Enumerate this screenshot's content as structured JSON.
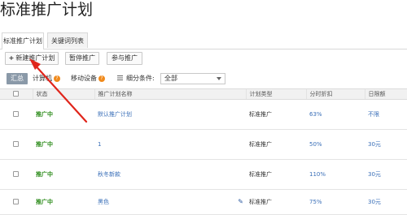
{
  "page": {
    "title": "标准推广计划"
  },
  "tabs": [
    {
      "label": "标准推广计划",
      "active": true
    },
    {
      "label": "关键词列表",
      "active": false
    }
  ],
  "toolbar": {
    "new_plan": "新建推广计划",
    "pause": "暂停推广",
    "join": "参与推广"
  },
  "filters": {
    "summary": "汇总",
    "computer": "计算机",
    "mobile": "移动设备",
    "segment_label": "细分条件:",
    "segment_value": "全部"
  },
  "table": {
    "headers": [
      "状态",
      "推广计划名称",
      "计划类型",
      "分时折扣",
      "日限额"
    ],
    "rows": [
      {
        "status": "推广中",
        "name": "默认推广计划",
        "type": "标准推广",
        "discount": "63%",
        "limit": "不限"
      },
      {
        "status": "推广中",
        "name": "1",
        "type": "标准推广",
        "discount": "50%",
        "limit": "30元"
      },
      {
        "status": "推广中",
        "name": "秋冬新款",
        "type": "标准推广",
        "discount": "110%",
        "limit": "30元"
      },
      {
        "status": "推广中",
        "name": "黑色",
        "type": "标准推广",
        "discount": "75%",
        "limit": "30元"
      }
    ]
  },
  "colors": {
    "status_green": "#2a8a18",
    "link_blue": "#3a6fb8",
    "annotation_red": "#e0251b",
    "badge_orange": "#f08a1c"
  }
}
